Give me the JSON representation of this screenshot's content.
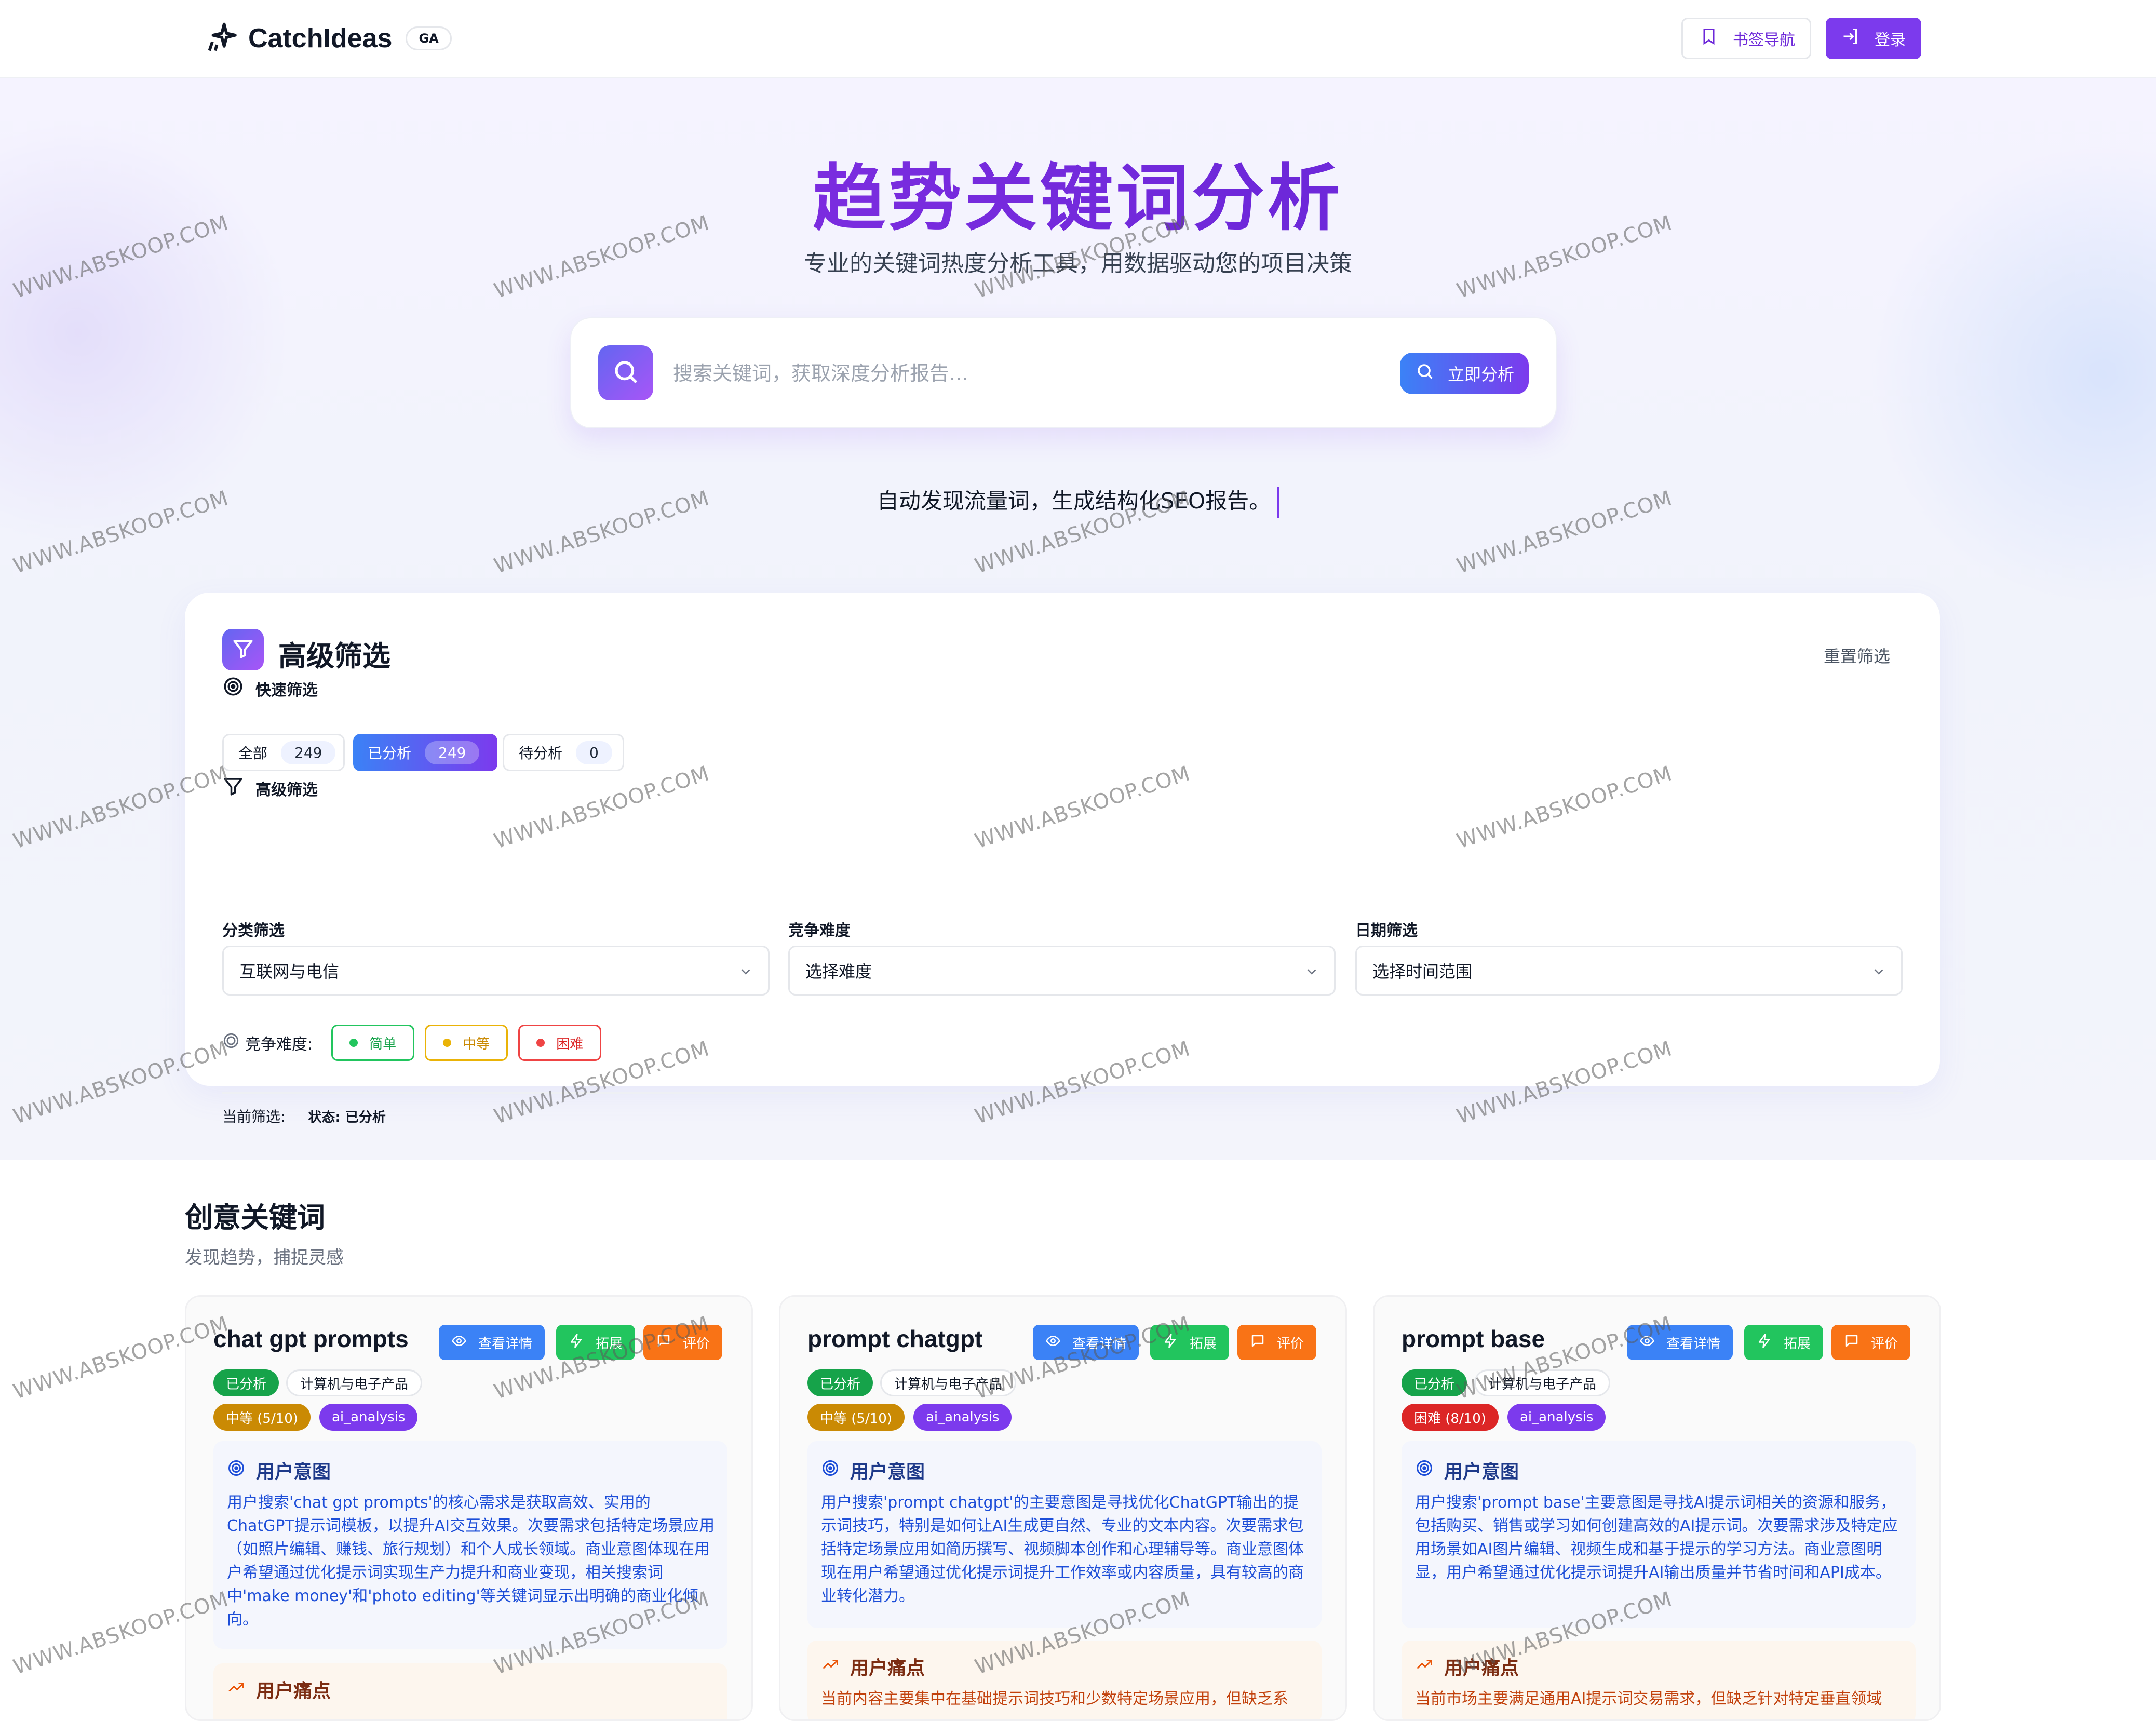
{
  "header": {
    "brand": "CatchIdeas",
    "badge": "GA",
    "bookmarks_label": "书签导航",
    "login_label": "登录"
  },
  "hero": {
    "title": "趋势关键词分析",
    "subtitle": "专业的关键词热度分析工具，用数据驱动您的项目决策",
    "search": {
      "placeholder": "搜索关键词，获取深度分析报告...",
      "value": "",
      "button_label": "立即分析"
    },
    "typing_text": "自动发现流量词，生成结构化SEO报告。"
  },
  "filters": {
    "title": "高级筛选",
    "reset_label": "重置筛选",
    "quick_label": "快速筛选",
    "quick_chips": [
      {
        "label": "全部",
        "count": "249",
        "active": false
      },
      {
        "label": "已分析",
        "count": "249",
        "active": true
      },
      {
        "label": "待分析",
        "count": "0",
        "active": false
      }
    ],
    "advanced_label": "高级筛选",
    "category": {
      "label": "分类筛选",
      "value": "互联网与电信"
    },
    "difficulty": {
      "label": "竞争难度",
      "value": "选择难度"
    },
    "date": {
      "label": "日期筛选",
      "value": "选择时间范围"
    },
    "difficulty_row_label": "竞争难度:",
    "difficulty_tags": [
      {
        "label": "简单",
        "color": "#16a34a"
      },
      {
        "label": "中等",
        "color": "#ca8a04"
      },
      {
        "label": "困难",
        "color": "#dc2626"
      }
    ],
    "current_label": "当前筛选:",
    "current_value": "状态: 已分析"
  },
  "section": {
    "title": "创意关键词",
    "subtitle": "发现趋势，捕捉灵感"
  },
  "card_buttons": {
    "view": "查看详情",
    "expand": "拓展",
    "rate": "评价"
  },
  "cards": [
    {
      "title": "chat gpt prompts",
      "status": "已分析",
      "category": "计算机与电子产品",
      "difficulty": "中等 (5/10)",
      "difficulty_level": "medium",
      "source": "ai_analysis",
      "intent_title": "用户意图",
      "intent_text": "用户搜索'chat gpt prompts'的核心需求是获取高效、实用的ChatGPT提示词模板，以提升AI交互效果。次要需求包括特定场景应用（如照片编辑、赚钱、旅行规划）和个人成长领域。商业意图体现在用户希望通过优化提示词实现生产力提升和商业变现，相关搜索词中'make money'和'photo editing'等关键词显示出明确的商业化倾向。",
      "pain_title": "用户痛点",
      "pain_text": ""
    },
    {
      "title": "prompt chatgpt",
      "status": "已分析",
      "category": "计算机与电子产品",
      "difficulty": "中等 (5/10)",
      "difficulty_level": "medium",
      "source": "ai_analysis",
      "intent_title": "用户意图",
      "intent_text": "用户搜索'prompt chatgpt'的主要意图是寻找优化ChatGPT输出的提示词技巧，特别是如何让AI生成更自然、专业的文本内容。次要需求包括特定场景应用如简历撰写、视频脚本创作和心理辅导等。商业意图体现在用户希望通过优化提示词提升工作效率或内容质量，具有较高的商业转化潜力。",
      "pain_title": "用户痛点",
      "pain_text": "当前内容主要集中在基础提示词技巧和少数特定场景应用，但缺乏系"
    },
    {
      "title": "prompt base",
      "status": "已分析",
      "category": "计算机与电子产品",
      "difficulty": "困难 (8/10)",
      "difficulty_level": "hard",
      "source": "ai_analysis",
      "intent_title": "用户意图",
      "intent_text": "用户搜索'prompt base'主要意图是寻找AI提示词相关的资源和服务，包括购买、销售或学习如何创建高效的AI提示词。次要需求涉及特定应用场景如AI图片编辑、视频生成和基于提示的学习方法。商业意图明显，用户希望通过优化提示词提升AI输出质量并节省时间和API成本。",
      "pain_title": "用户痛点",
      "pain_text": "当前市场主要满足通用AI提示词交易需求，但缺乏针对特定垂直领域"
    }
  ],
  "watermark": "WWW.ABSKOOP.COM"
}
